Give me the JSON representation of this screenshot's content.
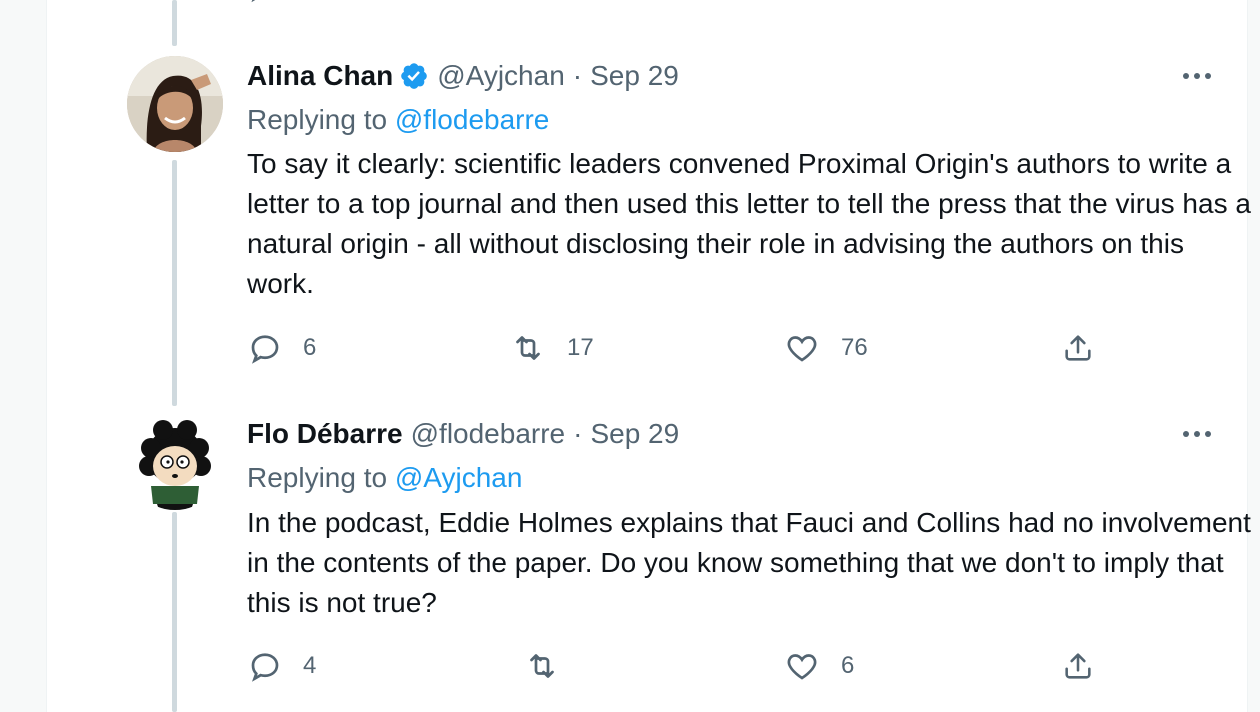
{
  "tweets": [
    {
      "name": "Alina Chan",
      "verified": true,
      "handle": "@Ayjchan",
      "separator": "·",
      "date": "Sep 29",
      "replying_prefix": "Replying to",
      "replying_to": "@flodebarre",
      "text": "To say it clearly: scientific leaders convened Proximal Origin's authors to write a letter to a top journal and then used this letter to tell the press that the virus has a natural origin - all without disclosing their role in advising the authors on this work.",
      "replies": "6",
      "retweets": "17",
      "likes": "76"
    },
    {
      "name": "Flo Débarre",
      "verified": false,
      "handle": "@flodebarre",
      "separator": "·",
      "date": "Sep 29",
      "replying_prefix": "Replying to",
      "replying_to": "@Ayjchan",
      "text": "In the podcast, Eddie Holmes explains that Fauci and Collins had no involvement in the contents of the paper. Do you know something that we don't to imply that this is not true?",
      "replies": "4",
      "retweets": "",
      "likes": "6"
    }
  ],
  "colors": {
    "accent": "#1d9bf0",
    "text": "#0f1419",
    "muted": "#536471",
    "thread_line": "#cfd9de"
  },
  "icons": {
    "more": "more-horizontal-icon",
    "reply": "reply-icon",
    "retweet": "retweet-icon",
    "like": "heart-icon",
    "share": "share-icon",
    "verified": "verified-badge-icon"
  }
}
